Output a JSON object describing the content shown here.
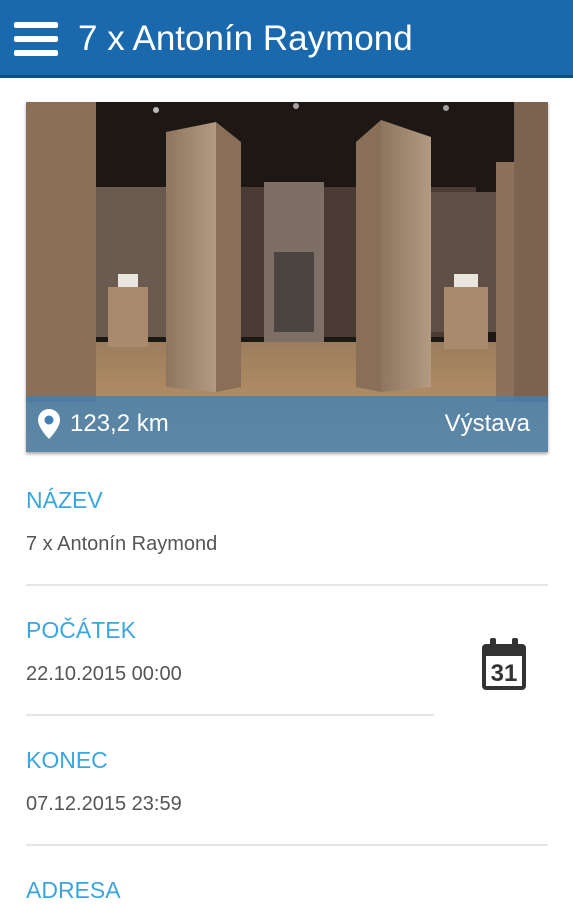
{
  "header": {
    "title": "7 x Antonín Raymond",
    "menu_icon": "hamburger-menu-icon"
  },
  "hero": {
    "distance": "123,2 km",
    "category": "Výstava",
    "location_icon": "map-pin-icon"
  },
  "fields": {
    "name": {
      "label": "NÁZEV",
      "value": "7 x Antonín Raymond"
    },
    "start": {
      "label": "POČÁTEK",
      "value": "22.10.2015 00:00"
    },
    "end": {
      "label": "KONEC",
      "value": "07.12.2015 23:59"
    },
    "address": {
      "label": "ADRESA"
    }
  },
  "calendar": {
    "icon": "calendar-icon",
    "day": "31"
  },
  "colors": {
    "appbar": "#1a69ad",
    "label": "#3aa6df",
    "value": "#555555"
  }
}
